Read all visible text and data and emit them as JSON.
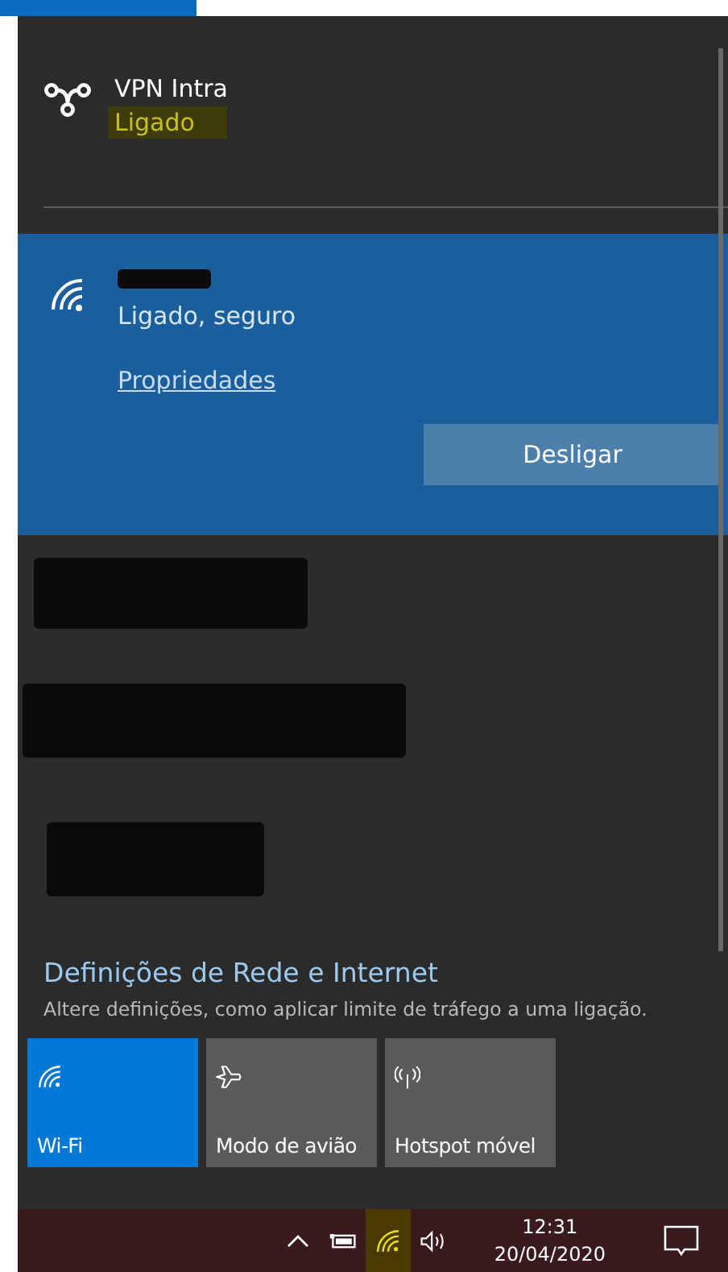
{
  "vpn": {
    "name": "VPN Intra",
    "status": "Ligado",
    "highlighted": true
  },
  "connected_network": {
    "status": "Ligado, seguro",
    "link": "Propriedades",
    "button": "Desligar"
  },
  "settings": {
    "title": "Definições de Rede e Internet",
    "description": "Altere definições, como aplicar limite de tráfego a uma ligação."
  },
  "tiles": [
    {
      "kind": "wifi",
      "label": "Wi-Fi",
      "on": true
    },
    {
      "kind": "airplane",
      "label": "Modo de avião",
      "on": false
    },
    {
      "kind": "hotspot",
      "label": "Hotspot móvel",
      "on": false
    }
  ],
  "taskbar": {
    "tray": [
      {
        "kind": "chevron",
        "highlighted": false
      },
      {
        "kind": "battery",
        "highlighted": false
      },
      {
        "kind": "wifi",
        "highlighted": true
      },
      {
        "kind": "volume",
        "highlighted": false
      }
    ],
    "time": "12:31",
    "date": "20/04/2020"
  }
}
